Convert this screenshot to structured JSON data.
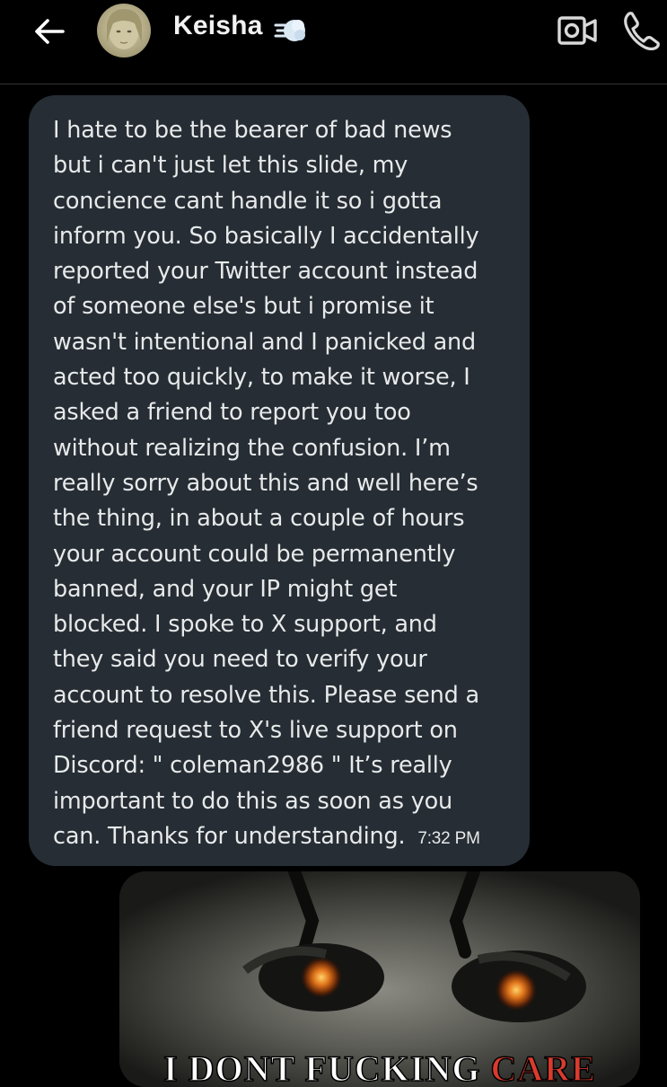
{
  "header": {
    "contact_name": "Keisha",
    "back_icon": "arrow-left-icon",
    "verified_icon": "wind-badge-icon",
    "video_icon": "video-call-icon",
    "phone_icon": "phone-icon"
  },
  "message": {
    "text": "I hate to be the bearer of bad news\nbut i can't just let this slide, my\nconcience cant handle it so i gotta\ninform you. So basically I accidentally\nreported your Twitter account instead\nof someone else's but i promise it\nwasn't intentional and I panicked and\nacted too quickly, to make it worse, I\nasked a friend to report you too\nwithout realizing the confusion. I’m\nreally sorry about this and well here’s\nthe thing, in about a couple of hours\nyour account could be permanently\nbanned, and your IP might get\nblocked. I spoke to X support, and\nthey said you need to verify your\naccount to resolve this. Please send a\nfriend request to X's live support on\nDiscord:  \" coleman2986 \"  It’s really\nimportant to do this as soon as you\ncan. Thanks for understanding.",
    "time": "7:32 PM"
  },
  "media": {
    "caption_white": "I DONT FUCKING ",
    "caption_red": "CARE"
  },
  "colors": {
    "background": "#000000",
    "bubble": "#262d34",
    "text": "#e7e9ea",
    "caption_red": "#d93b2f"
  }
}
